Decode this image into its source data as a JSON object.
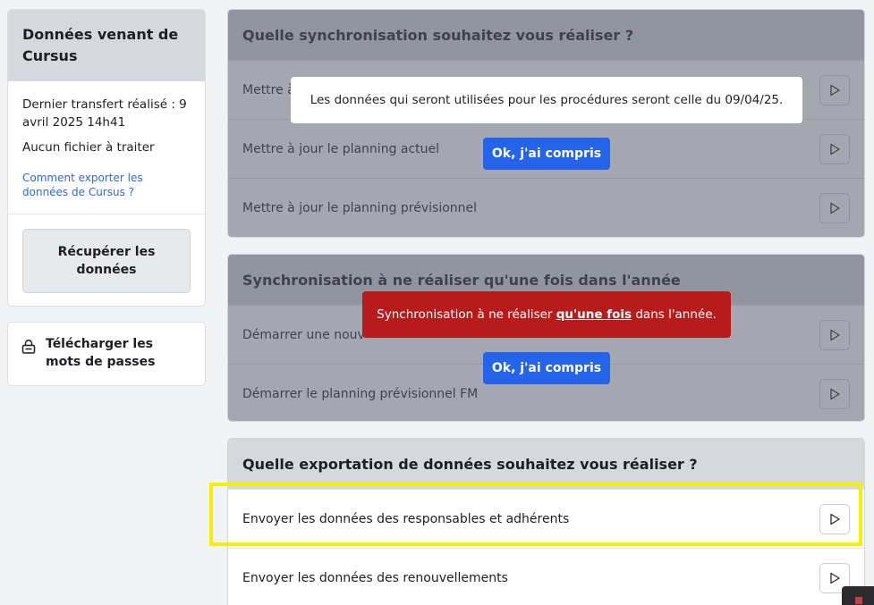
{
  "sidebar": {
    "cursus_title": "Données venant de Cursus",
    "last_transfer": "Dernier transfert réalisé : 9 avril 2025 14h41",
    "file_status": "Aucun fichier à traiter",
    "export_help_link": "Comment exporter les données de Cursus ?",
    "fetch_button": "Récupérer les données",
    "download_passwords": "Télécharger les mots de passes"
  },
  "sync_section": {
    "title": "Quelle synchronisation souhaitez vous réaliser ?",
    "rows": [
      "Mettre à",
      "Mettre à jour le planning actuel",
      "Mettre à jour le planning prévisionnel"
    ]
  },
  "yearly_section": {
    "title": "Synchronisation à ne réaliser qu'une fois dans l'année",
    "rows": [
      "Démarrer une nouv",
      "Démarrer le planning prévisionnel FM"
    ]
  },
  "export_section": {
    "title": "Quelle exportation de données souhaitez vous réaliser ?",
    "rows": [
      "Envoyer les données des responsables et adhérents",
      "Envoyer les données des renouvellements"
    ]
  },
  "popups": {
    "info_text": "Les données qui seront utilisées pour les procédures seront celle du 09/04/25.",
    "warn_prefix": "Synchronisation à ne réaliser ",
    "warn_emphasis": "qu'une fois",
    "warn_suffix": " dans l'année.",
    "ok_label": "Ok, j'ai compris"
  },
  "colors": {
    "header_gray": "#d6d8de",
    "overlay": "#5a5f6e",
    "ok_button": "#2563eb",
    "warning_red": "#b71c1c",
    "highlight_yellow": "#f5ef00",
    "link_blue": "#2f6ad8"
  },
  "icons": [
    "play-icon",
    "lock-icon"
  ]
}
